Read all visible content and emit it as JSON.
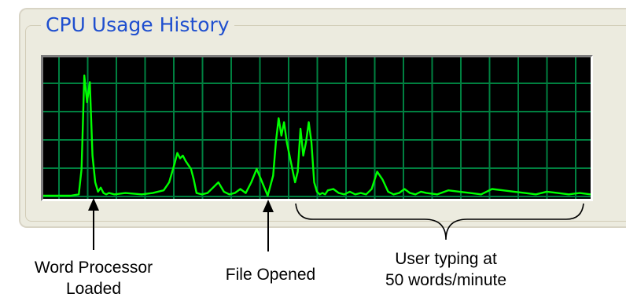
{
  "panel": {
    "title": "CPU Usage History"
  },
  "colors": {
    "panel_background": "#ecebdf",
    "title_text": "#1f4fcf",
    "graph_background": "#000000",
    "grid_line": "#008040",
    "usage_line": "#00ff00"
  },
  "chart_data": {
    "type": "line",
    "title": "CPU Usage History",
    "xlabel": "",
    "ylabel": "",
    "grid": true,
    "ylim": [
      0,
      100
    ],
    "x_range": [
      0,
      100
    ],
    "series": [
      {
        "x": [
          0,
          5,
          6.5,
          7,
          7.5,
          8,
          8.5,
          9,
          9.5,
          10,
          10.5,
          11,
          11.5,
          12,
          13,
          15,
          18,
          20,
          22,
          23,
          24,
          24.5,
          25,
          25.5,
          26,
          27,
          27.5,
          28,
          29,
          30,
          31,
          32,
          33,
          34,
          35,
          36,
          37,
          38,
          39,
          40,
          41,
          42,
          42.5,
          43,
          43.5,
          44,
          44.5,
          45,
          45.5,
          46,
          46.5,
          47,
          47.5,
          48,
          48.5,
          49,
          49.5,
          50,
          50.5,
          51,
          51.5,
          52,
          53,
          54,
          55,
          56,
          57,
          58,
          59,
          60,
          61,
          62,
          63,
          64,
          65,
          66,
          67,
          68,
          69,
          70,
          72,
          74,
          76,
          78,
          80,
          82,
          84,
          86,
          88,
          90,
          92,
          94,
          96,
          98,
          100
        ],
        "y": [
          0,
          0,
          1,
          20,
          90,
          70,
          85,
          30,
          10,
          3,
          6,
          2,
          1,
          2,
          1,
          2,
          1,
          2,
          4,
          10,
          24,
          32,
          28,
          30,
          26,
          20,
          12,
          2,
          1,
          2,
          6,
          10,
          3,
          1,
          2,
          5,
          2,
          10,
          20,
          10,
          0,
          15,
          40,
          58,
          45,
          55,
          40,
          30,
          20,
          10,
          18,
          50,
          30,
          40,
          55,
          40,
          10,
          3,
          1,
          2,
          1,
          4,
          5,
          2,
          1,
          3,
          1,
          2,
          1,
          5,
          18,
          12,
          3,
          1,
          2,
          5,
          2,
          1,
          3,
          2,
          1,
          4,
          3,
          2,
          1,
          5,
          4,
          3,
          2,
          1,
          3,
          2,
          1,
          2,
          1
        ]
      }
    ],
    "annotations": [
      "Word Processor Loaded",
      "File Opened",
      "User typing at 50 words/minute"
    ]
  },
  "annotations": {
    "word_processor": {
      "line1": "Word Processor",
      "line2": "Loaded"
    },
    "file_opened": {
      "line1": "File Opened"
    },
    "user_typing": {
      "line1": "User typing at",
      "line2": "50 words/minute"
    }
  }
}
